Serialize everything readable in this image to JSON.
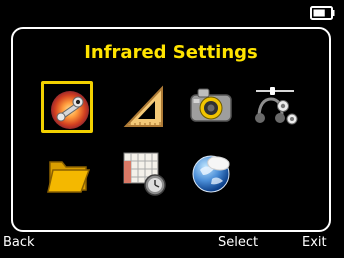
{
  "screen": {
    "title": "Infrared Settings"
  },
  "status": {
    "battery_icon": "battery-icon",
    "battery_level": 0.75
  },
  "menu_items": [
    {
      "icon": "infrared-settings-icon",
      "selected": true
    },
    {
      "icon": "measurement-triangle-icon",
      "selected": false
    },
    {
      "icon": "camera-icon",
      "selected": false
    },
    {
      "icon": "audio-settings-icon",
      "selected": false
    },
    {
      "icon": "folder-icon",
      "selected": false
    },
    {
      "icon": "calendar-clock-icon",
      "selected": false
    },
    {
      "icon": "globe-icon",
      "selected": false
    }
  ],
  "softkeys": {
    "left": "Back",
    "center": "Select",
    "right": "Exit"
  },
  "colors": {
    "background": "#000000",
    "panel_border": "#ffffff",
    "title": "#ffe400",
    "selection": "#f2d000"
  }
}
